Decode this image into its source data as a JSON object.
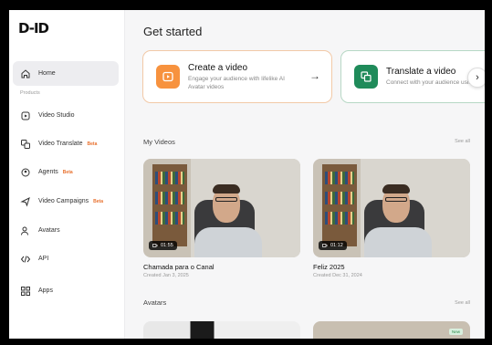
{
  "app": {
    "logo_text": "D-ID"
  },
  "sidebar": {
    "section_label": "Products",
    "items": [
      {
        "label": "Home",
        "icon": "home-icon",
        "badge": ""
      },
      {
        "label": "Video Studio",
        "icon": "video-studio-icon",
        "badge": ""
      },
      {
        "label": "Video Translate",
        "icon": "translate-icon",
        "badge": "Beta"
      },
      {
        "label": "Agents",
        "icon": "agents-icon",
        "badge": "Beta"
      },
      {
        "label": "Video Campaigns",
        "icon": "campaigns-icon",
        "badge": "Beta"
      },
      {
        "label": "Avatars",
        "icon": "avatars-icon",
        "badge": ""
      },
      {
        "label": "API",
        "icon": "api-icon",
        "badge": ""
      },
      {
        "label": "Apps",
        "icon": "apps-icon",
        "badge": ""
      }
    ]
  },
  "main": {
    "title": "Get started",
    "cards": [
      {
        "title": "Create a video",
        "desc": "Engage your audience with lifelike AI Avatar videos",
        "icon": "create-video-icon",
        "accent": "#f7923e"
      },
      {
        "title": "Translate a video",
        "desc": "Connect with your audience using their native language",
        "icon": "translate-video-icon",
        "accent": "#1f8b5a"
      }
    ],
    "my_videos": {
      "label": "My Videos",
      "see_all": "See all",
      "videos": [
        {
          "title": "Chamada para o Canal",
          "date": "Created Jan 3, 2025",
          "duration": "01:55"
        },
        {
          "title": "Feliz 2025",
          "date": "Created Dec 31, 2024",
          "duration": "01:12"
        }
      ]
    },
    "avatars": {
      "label": "Avatars",
      "see_all": "See all",
      "tag": "New"
    }
  }
}
